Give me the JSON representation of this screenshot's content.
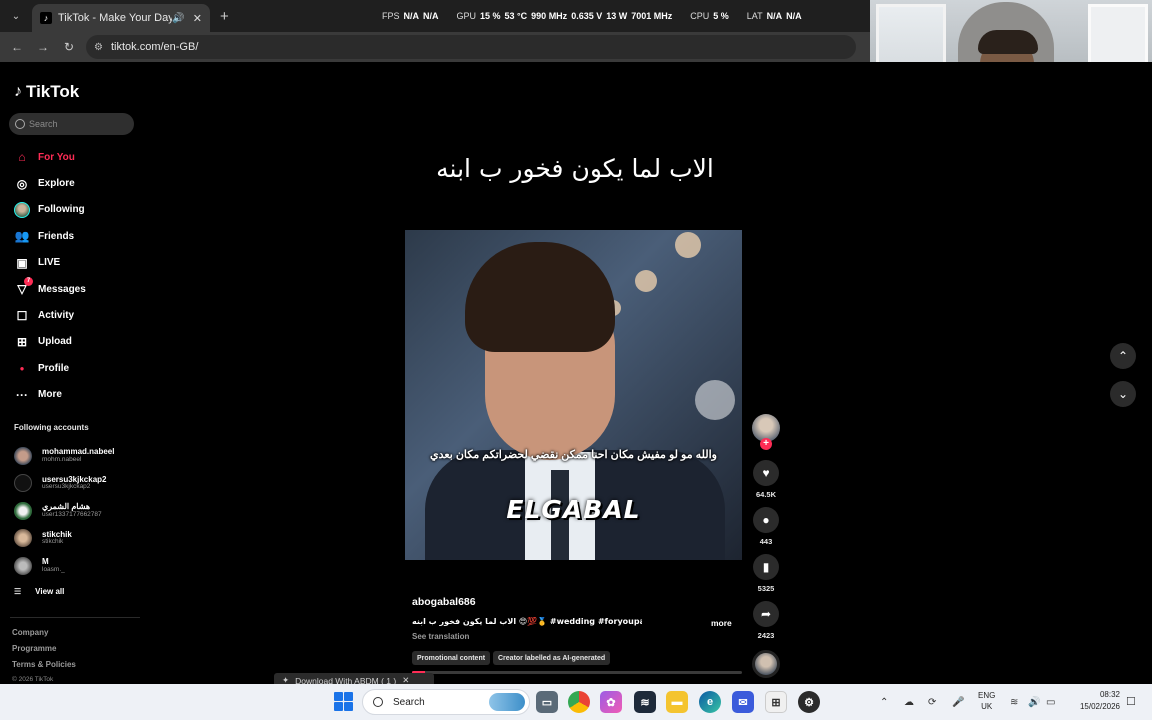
{
  "browser": {
    "tab_title": "TikTok - Make Your Day",
    "url": "tiktok.com/en-GB/",
    "stats": {
      "fps_label": "FPS",
      "fps_v1": "N/A",
      "fps_v2": "N/A",
      "gpu_label": "GPU",
      "gpu_util": "15 %",
      "gpu_temp": "53 °C",
      "gpu_clock": "990 MHz",
      "gpu_volt": "0.635 V",
      "gpu_power": "13 W",
      "gpu_mem": "7001 MHz",
      "cpu_label": "CPU",
      "cpu_util": "5 %",
      "lat_label": "LAT",
      "lat_v1": "N/A",
      "lat_v2": "N/A"
    }
  },
  "sidebar": {
    "logo": "TikTok",
    "search_placeholder": "Search",
    "nav": [
      {
        "label": "For You",
        "icon": "home-icon"
      },
      {
        "label": "Explore",
        "icon": "compass-icon"
      },
      {
        "label": "Following",
        "icon": "following-avatar-icon"
      },
      {
        "label": "Friends",
        "icon": "friends-icon"
      },
      {
        "label": "LIVE",
        "icon": "live-icon"
      },
      {
        "label": "Messages",
        "icon": "messages-icon",
        "badge": "7"
      },
      {
        "label": "Activity",
        "icon": "activity-icon"
      },
      {
        "label": "Upload",
        "icon": "upload-icon"
      },
      {
        "label": "Profile",
        "icon": "profile-icon"
      },
      {
        "label": "More",
        "icon": "more-icon"
      }
    ],
    "following_header": "Following accounts",
    "accounts": [
      {
        "name": "mohammad.nabeel",
        "handle": "mohm.nabeel"
      },
      {
        "name": "usersu3kjkckap2",
        "handle": "usersu3kjkckap2"
      },
      {
        "name": "هشام الشمري",
        "handle": "user1337177662787"
      },
      {
        "name": "stikchik",
        "handle": "stikchik"
      },
      {
        "name": "M",
        "handle": "loasm._"
      }
    ],
    "view_all": "View all",
    "footer": {
      "company": "Company",
      "programme": "Programme",
      "terms": "Terms & Policies",
      "copyright": "© 2026 TikTok"
    }
  },
  "video": {
    "top_caption": "الاب لما يكون فخور ب ابنه",
    "subtitle": "والله مو لو مفيش مكان احنا ممكن نقضي لحضراتكم مكان بعدي",
    "brand_text": "ELGABAL",
    "author": "abogabal686",
    "description": "الاب لما يكون فخور ب ابنه 😍💯🥇 #wedding #foryoupage ...",
    "more": "more",
    "see_translation": "See translation",
    "chip_promo": "Promotional content",
    "chip_ai": "Creator labelled as AI-generated",
    "progress": 0.04
  },
  "actions": {
    "likes": "64.5K",
    "comments": "443",
    "saves": "5325",
    "shares": "2423"
  },
  "download_toast": "Download With ABDM ( 1 )",
  "taskbar": {
    "search": "Search",
    "lang_top": "ENG",
    "lang_bottom": "UK",
    "time": "08:32",
    "date": "15/02/2026"
  },
  "colors": {
    "accent": "#fe2c55",
    "background": "#000000",
    "taskbar": "#eef1f6"
  }
}
